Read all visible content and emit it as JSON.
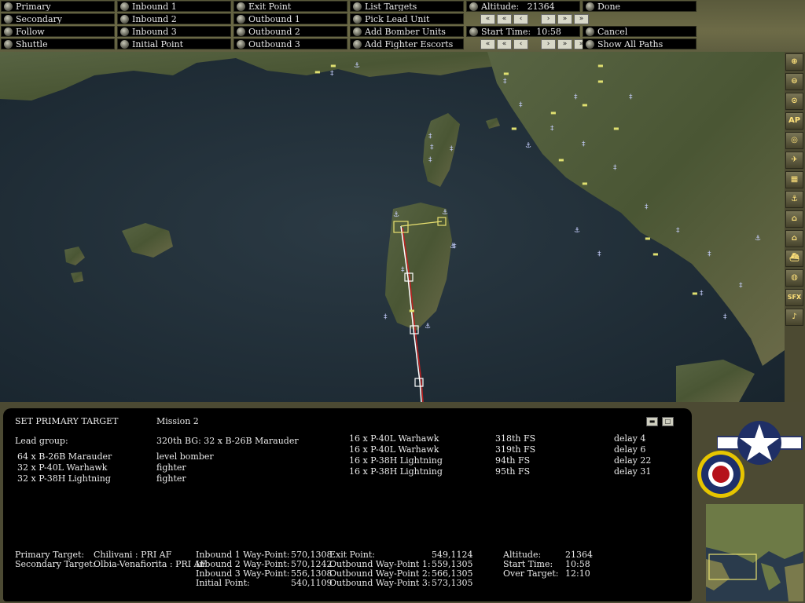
{
  "menu": {
    "col1": [
      "Primary",
      "Secondary",
      "Follow",
      "Shuttle"
    ],
    "col2": [
      "Inbound 1",
      "Inbound 2",
      "Inbound 3",
      "Initial Point"
    ],
    "col3": [
      "Exit Point",
      "Outbound 1",
      "Outbound 2",
      "Outbound 3"
    ],
    "col4": [
      "List Targets",
      "Pick Lead Unit",
      "Add Bomber Units",
      "Add Fighter Escorts"
    ],
    "altitude_label": "Altitude:",
    "altitude_value": "21364",
    "start_time_label": "Start Time:",
    "start_time_value": "10:58",
    "done": "Done",
    "cancel": "Cancel",
    "show_all_paths": "Show All Paths",
    "stepper_glyphs": [
      "«",
      "«",
      "‹",
      "›",
      "»",
      "»"
    ]
  },
  "sidebar": {
    "buttons": [
      {
        "name": "zoom-in-icon",
        "glyph": "⊕"
      },
      {
        "name": "zoom-out-icon",
        "glyph": "⊖"
      },
      {
        "name": "center-icon",
        "glyph": "⊙"
      },
      {
        "name": "ap-icon",
        "glyph": "AP"
      },
      {
        "name": "target-icon",
        "glyph": "◎"
      },
      {
        "name": "airfield-icon",
        "glyph": "✈"
      },
      {
        "name": "rail-icon",
        "glyph": "▦"
      },
      {
        "name": "port-icon",
        "glyph": "⚓"
      },
      {
        "name": "factory-icon",
        "glyph": "⌂"
      },
      {
        "name": "building-icon",
        "glyph": "⌂"
      },
      {
        "name": "ship-icon",
        "glyph": "⛴"
      },
      {
        "name": "compass-icon",
        "glyph": "◍"
      },
      {
        "name": "sfx-icon",
        "glyph": "SFX"
      },
      {
        "name": "music-icon",
        "glyph": "♪"
      }
    ]
  },
  "panel": {
    "title": "SET PRIMARY TARGET",
    "mission": "Mission  2",
    "lead_group_label": "Lead group:",
    "lead_group_value": "320th BG:  32 x B-26B Marauder",
    "units": [
      {
        "qty": "64  x B-26B Marauder",
        "role": "level bomber"
      },
      {
        "qty": "32  x P-40L Warhawk",
        "role": "fighter"
      },
      {
        "qty": "32  x P-38H Lightning",
        "role": "fighter"
      }
    ],
    "escorts": [
      {
        "unit": "16  x P-40L Warhawk",
        "sq": "318th FS",
        "delay": "delay  4"
      },
      {
        "unit": "16  x P-40L Warhawk",
        "sq": "319th FS",
        "delay": "delay  6"
      },
      {
        "unit": "16  x P-38H Lightning",
        "sq": "94th FS",
        "delay": "delay  22"
      },
      {
        "unit": "16  x P-38H Lightning",
        "sq": "95th FS",
        "delay": "delay  31"
      }
    ],
    "targets": {
      "primary_label": "Primary Target:",
      "primary_value": "Chilivani : PRI AF",
      "secondary_label": "Secondary Target:",
      "secondary_value": "Olbia-Venafiorita : PRI AF"
    },
    "waypoints_a": [
      {
        "label": "Inbound 1 Way-Point:",
        "value": "570,1308"
      },
      {
        "label": "Inbound 2 Way-Point:",
        "value": "570,1242"
      },
      {
        "label": "Inbound 3 Way-Point:",
        "value": "556,1308"
      },
      {
        "label": "Initial Point:",
        "value": "540,1109"
      }
    ],
    "waypoints_b": [
      {
        "label": "Exit Point:",
        "value": "549,1124"
      },
      {
        "label": "Outbound Way-Point 1:",
        "value": "559,1305"
      },
      {
        "label": "Outbound Way-Point 2:",
        "value": "566,1305"
      },
      {
        "label": "Outbound Way-Point 3:",
        "value": "573,1305"
      }
    ],
    "summary": [
      {
        "label": "Altitude:",
        "value": "21364"
      },
      {
        "label": "Start Time:",
        "value": "10:58"
      },
      {
        "label": "Over Target:",
        "value": "12:10"
      }
    ]
  },
  "colors": {
    "sea": "#1c2a35",
    "land": "#4d5a36",
    "route_red": "#c02020",
    "route_white": "#ffffff",
    "route_yellow": "#e8e070",
    "button_bg": "#000000",
    "panel_frame": "#4c4a33"
  }
}
